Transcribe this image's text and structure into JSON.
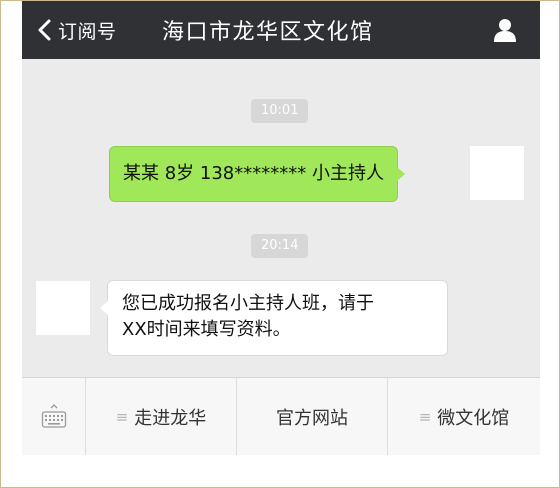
{
  "header": {
    "back_label": "订阅号",
    "title": "海口市龙华区文化馆"
  },
  "messages": [
    {
      "type": "timestamp",
      "text": "10:01"
    },
    {
      "type": "outgoing",
      "text": "某某 8岁 138******** 小主持人"
    },
    {
      "type": "timestamp",
      "text": "20:14"
    },
    {
      "type": "incoming",
      "lines": [
        "您已成功报名小主持人班，请于",
        "XX时间来填写资料。"
      ]
    }
  ],
  "menu": {
    "items": [
      {
        "label": "走进龙华",
        "icon": "menu-lines-icon"
      },
      {
        "label": "官方网站",
        "icon": ""
      },
      {
        "label": "微文化馆",
        "icon": "menu-lines-icon"
      }
    ]
  },
  "colors": {
    "header_bg": "#2f3134",
    "chat_bg": "#ebebeb",
    "outgoing_bubble": "#a0e75a",
    "frame_border": "#c9b98c"
  },
  "icons": [
    "back-chevron-icon",
    "person-icon",
    "keyboard-icon",
    "menu-lines-icon"
  ]
}
